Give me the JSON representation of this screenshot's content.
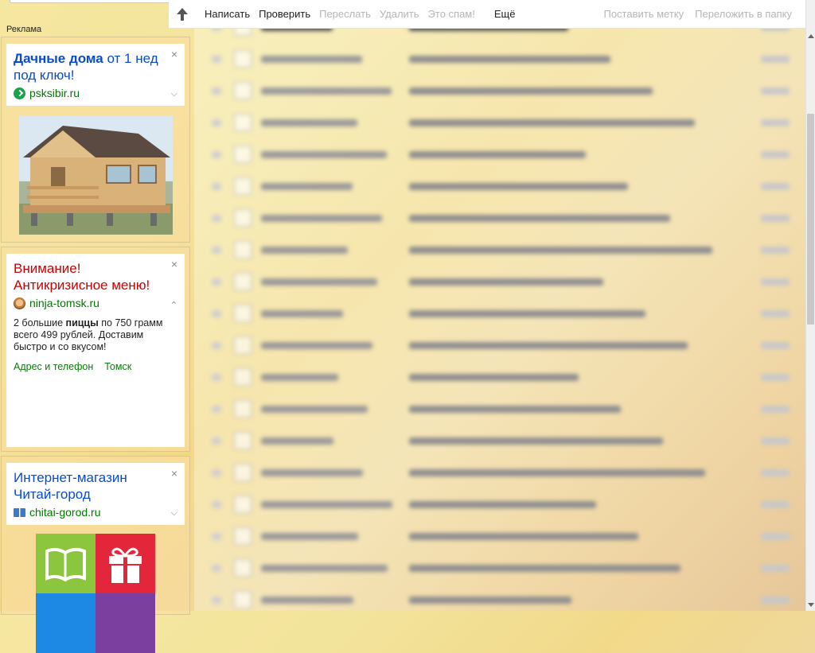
{
  "ads": {
    "label": "Реклама",
    "ad1": {
      "title_bold": "Дачные дома",
      "title_rest": " от 1 нед под ключ!",
      "domain": "psksibir.ru",
      "close": "×",
      "toggle": "⌵"
    },
    "ad2": {
      "title": "Внимание! Антикризисное меню!",
      "domain": "ninja-tomsk.ru",
      "close": "×",
      "toggle": "⌃",
      "text_before": "2 большие ",
      "text_bold": "пиццы",
      "text_after": " по 750 грамм всего 499 рублей. Доставим быстро и со вкусом!",
      "link1": "Адрес и телефон",
      "link2": "Томск"
    },
    "ad3": {
      "title": "Интернет-магазин Читай-город",
      "domain": "chitai-gorod.ru",
      "close": "×",
      "toggle": "⌵",
      "tile_colors": [
        "#8cc63f",
        "#e3263a",
        "#1e88e5",
        "#7b3fa0"
      ]
    }
  },
  "toolbar": {
    "up_icon": "arrow-up-icon",
    "compose": "Написать",
    "check": "Проверить",
    "forward": "Переслать",
    "delete": "Удалить",
    "spam": "Это спам!",
    "more": "Ещё",
    "label": "Поставить метку",
    "move": "Переложить в папку"
  },
  "colors": {
    "ad_title_blue": "#0a4ccc",
    "ad_title_red": "#cc0000",
    "ad_domain_green": "#007700",
    "disabled_gray": "#b5b5b5"
  }
}
